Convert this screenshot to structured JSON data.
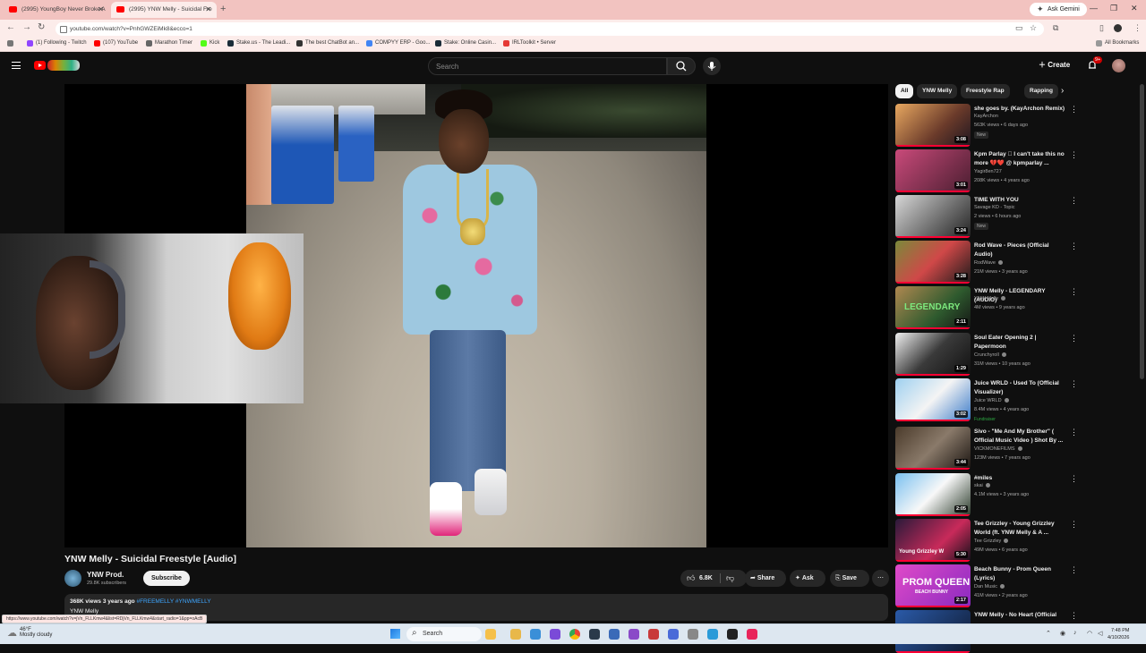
{
  "browser": {
    "tabs": [
      {
        "title": "(2995) YoungBoy Never Broke A",
        "active": false
      },
      {
        "title": "(2995) YNW Melly - Suicidal Fre",
        "active": true
      }
    ],
    "new_tab": "+",
    "gemini_label": "Ask Gemini",
    "url": "youtube.com/watch?v=PnhGWZEiMk8&ecco=1",
    "bookmarks": [
      {
        "label": "(1) Following - Twitch",
        "color": "#9146ff"
      },
      {
        "label": "(107) YouTube",
        "color": "#ff0000"
      },
      {
        "label": "Marathon Timer",
        "color": "#666666"
      },
      {
        "label": "Kick",
        "color": "#53fc18"
      },
      {
        "label": "Stake.us - The Leadi...",
        "color": "#1a2c38"
      },
      {
        "label": "The best ChatBot an...",
        "color": "#333333"
      },
      {
        "label": "COMPYY ERP - Goo...",
        "color": "#4285f4"
      },
      {
        "label": "Stake: Online Casin...",
        "color": "#1a2c38"
      },
      {
        "label": "IRLToolkit • Server",
        "color": "#e53935"
      }
    ],
    "all_bookmarks": "All Bookmarks"
  },
  "youtube": {
    "search_placeholder": "Search",
    "create_label": "Create",
    "notifications_badge": "9+"
  },
  "video": {
    "title": "YNW Melly - Suicidal Freestyle [Audio]",
    "channel": "YNW Prod.",
    "subscribers": "29.8K subscribers",
    "subscribe_label": "Subscribe",
    "likes": "6.8K",
    "share_label": "Share",
    "ask_label": "Ask",
    "save_label": "Save",
    "views_line": "368K views  3 years ago",
    "hashtags": "#FREEMELLY #YNWMELLY",
    "description_line": "YNW Melly"
  },
  "sidebar": {
    "chips": [
      "All",
      "YNW Melly",
      "Freestyle Rap",
      "Rapping"
    ],
    "recommendations": [
      {
        "title": "she goes by. (KayArchon Remix)",
        "channel": "KayArchon",
        "views": "563K views • 6 days ago",
        "duration": "3:08",
        "badge": "New",
        "verified": false,
        "thumb": "linear-gradient(135deg,#e8a860,#6a3a2a 60%,#1e1620)"
      },
      {
        "title": "Kpm Parlay 🏻 I can't take this no more 💔❤️ @ kpmparlay ...",
        "channel": "Yagir8en727",
        "views": "208K views • 4 years ago",
        "duration": "3:01",
        "badge": "",
        "verified": false,
        "thumb": "linear-gradient(135deg,#c94a7a,#4a1e30)"
      },
      {
        "title": "TIME WITH YOU",
        "channel": "Savage KD - Topic",
        "views": "2 views • 6 hours ago",
        "duration": "3:24",
        "badge": "New",
        "verified": false,
        "thumb": "linear-gradient(135deg,#d8d8d8,#6a6a6a 60%,#222)"
      },
      {
        "title": "Rod Wave - Pieces (Official Audio)",
        "channel": "RodWave",
        "views": "21M views • 3 years ago",
        "duration": "3:28",
        "badge": "",
        "verified": true,
        "thumb": "linear-gradient(135deg,#7a8a3a,#d04848 50%,#1a1a1a)"
      },
      {
        "title": "YNW Melly - LEGENDARY (AUDIO)",
        "channel": "YNW Melly",
        "views": "4M views • 9 years ago",
        "duration": "2:11",
        "badge": "",
        "verified": true,
        "thumb": "linear-gradient(135deg,#b08850,#2e5a2e 60%,#141414)"
      },
      {
        "title": "Soul Eater Opening 2 | Papermoon",
        "channel": "Crunchyroll",
        "views": "31M views • 10 years ago",
        "duration": "1:29",
        "badge": "",
        "verified": true,
        "thumb": "linear-gradient(135deg,#f0f0f0,#3a3a3a 50%,#101010)"
      },
      {
        "title": "Juice WRLD - Used To (Official Visualizer)",
        "channel": "Juice WRLD",
        "views": "8.4M views • 4 years ago",
        "duration": "3:02",
        "badge": "Fundraiser",
        "verified": true,
        "thumb": "linear-gradient(135deg,#9ed0f0,#f4f4f4 50%,#3a7ac8)"
      },
      {
        "title": "Sivo - \"Me And My Brother\" ( Official Music Video ) Shot By ...",
        "channel": "VICKMONEFILMS",
        "views": "123M views • 7 years ago",
        "duration": "3:44",
        "badge": "",
        "verified": true,
        "thumb": "linear-gradient(135deg,#4a3a2a,#8a7a6a 50%,#1a1410)"
      },
      {
        "title": "#miles",
        "channel": "skai",
        "views": "4.1M views • 3 years ago",
        "duration": "2:05",
        "badge": "",
        "verified": true,
        "thumb": "linear-gradient(135deg,#7ac0f0,#f8f8f8 50%,#2a3a2a)"
      },
      {
        "title": "Tee Grizzley - Young Grizzley World (ft. YNW Melly & A ...",
        "channel": "Tee Grizzley",
        "views": "49M views • 6 years ago",
        "duration": "5:30",
        "badge": "",
        "verified": true,
        "thumb": "linear-gradient(135deg,#2a1a3a,#c82a5a 60%,#101018)"
      },
      {
        "title": "Beach Bunny - Prom Queen (Lyrics)",
        "channel": "Dan Music",
        "views": "41M views • 2 years ago",
        "duration": "2:17",
        "badge": "",
        "verified": true,
        "thumb": "linear-gradient(135deg,#e04ac8,#8a2ac0)"
      },
      {
        "title": "YNW Melly - No Heart (Official",
        "channel": "",
        "views": "",
        "duration": "",
        "badge": "",
        "verified": false,
        "thumb": "linear-gradient(135deg,#2a5aa8,#101a30)"
      }
    ]
  },
  "overlay": {
    "legendary_text": "LEGENDARY",
    "prom_queen_text": "PROM QUEEN",
    "beach_bunny_text": "BEACH BUNNY",
    "young_grizzley_text": "Young Grizzley W"
  },
  "status_url": "https://www.youtube.com/watch?v=jVn_FLLKmw4&list=RDjVn_FLLKmw4&start_radio=1&pp=oAcB",
  "taskbar": {
    "weather_temp": "46°F",
    "weather_desc": "Mostly cloudy",
    "search_label": "Search",
    "time": "7:48 PM",
    "date": "4/10/2026"
  }
}
